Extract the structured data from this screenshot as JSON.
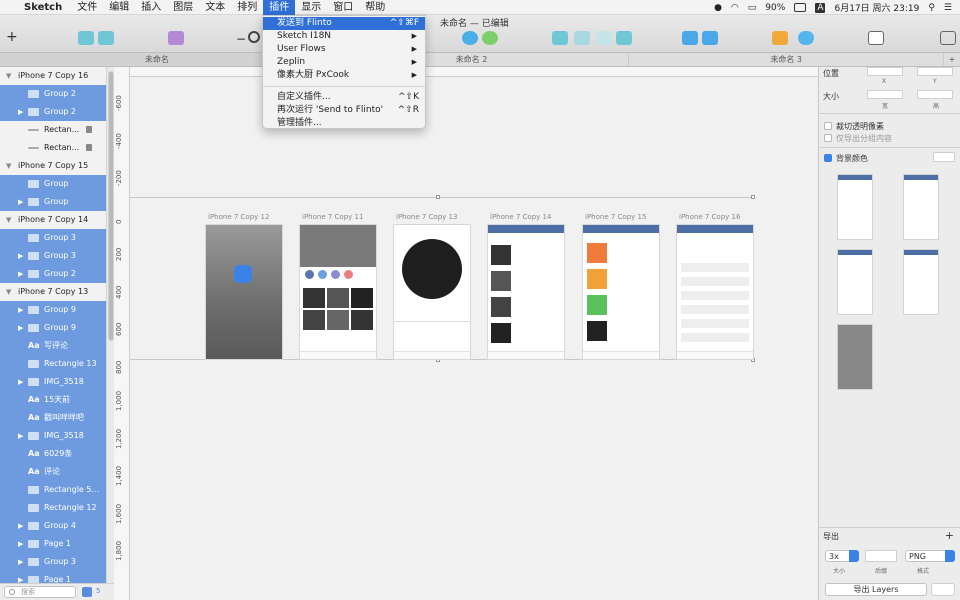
{
  "menubar": {
    "app_name": "Sketch",
    "items": [
      "文件",
      "编辑",
      "插入",
      "图层",
      "文本",
      "排列",
      "插件",
      "显示",
      "窗口",
      "帮助"
    ],
    "battery": "90%",
    "clock": "6月17日 周六  23:19",
    "input_method": "A"
  },
  "document": {
    "title": "未命名 — 已编辑"
  },
  "tabs": [
    "未命名",
    "未命名 2",
    "未命名 3"
  ],
  "plugin_menu": {
    "items": [
      {
        "label": "发送到 Flinto",
        "shortcut": "^⇧⌘F"
      },
      {
        "label": "Sketch I18N",
        "submenu": "▶"
      },
      {
        "label": "User Flows",
        "submenu": "▶"
      },
      {
        "label": "Zeplin",
        "submenu": "▶"
      },
      {
        "label": "像素大厨 PxCook",
        "submenu": "▶"
      }
    ],
    "items2": [
      {
        "label": "自定义插件...",
        "shortcut": "^⇧K"
      },
      {
        "label": "再次运行 'Send to Flinto'",
        "shortcut": "^⇧R"
      },
      {
        "label": "管理插件..."
      }
    ]
  },
  "layers": [
    {
      "kind": "group",
      "label": "iPhone 7 Copy 16"
    },
    {
      "kind": "sel-slice",
      "label": "Group 2"
    },
    {
      "kind": "sel",
      "label": "Group 2"
    },
    {
      "kind": "plain",
      "label": "Rectan...",
      "lock": true
    },
    {
      "kind": "plain",
      "label": "Rectan...",
      "lock": true
    },
    {
      "kind": "group",
      "label": "iPhone 7 Copy 15"
    },
    {
      "kind": "sel-slice",
      "label": "Group"
    },
    {
      "kind": "sel",
      "label": "Group"
    },
    {
      "kind": "group",
      "label": "iPhone 7 Copy 14"
    },
    {
      "kind": "sel-slice",
      "label": "Group 3"
    },
    {
      "kind": "sel",
      "label": "Group 3"
    },
    {
      "kind": "sel",
      "label": "Group 2"
    },
    {
      "kind": "group",
      "label": "iPhone 7 Copy 13"
    },
    {
      "kind": "sel",
      "label": "Group 9"
    },
    {
      "kind": "sel",
      "label": "Group 9"
    },
    {
      "kind": "text",
      "label": "写评论"
    },
    {
      "kind": "rect",
      "label": "Rectangle 13"
    },
    {
      "kind": "sel",
      "label": "IMG_3518"
    },
    {
      "kind": "text",
      "label": "15天前"
    },
    {
      "kind": "text",
      "label": "戳叫咩咩吧"
    },
    {
      "kind": "sel",
      "label": "IMG_3518"
    },
    {
      "kind": "text",
      "label": "6029条"
    },
    {
      "kind": "text",
      "label": "评论"
    },
    {
      "kind": "rect",
      "label": "Rectangle 5..."
    },
    {
      "kind": "rect",
      "label": "Rectangle 12"
    },
    {
      "kind": "sel",
      "label": "Group 4"
    },
    {
      "kind": "sel",
      "label": "Page 1"
    },
    {
      "kind": "sel",
      "label": "Group 3"
    },
    {
      "kind": "sel",
      "label": "Page 1"
    }
  ],
  "layer_footer": {
    "search_placeholder": "搜索",
    "filter_count": "5"
  },
  "ruler_ticks": [
    "-600",
    "-400",
    "-200",
    "0",
    "200",
    "400",
    "600",
    "800",
    "1,000",
    "1,200",
    "1,400",
    "1,600",
    "1,800"
  ],
  "artboards": [
    {
      "label": "iPhone 7 Copy 12"
    },
    {
      "label": "iPhone 7 Copy 11"
    },
    {
      "label": "iPhone 7 Copy 13"
    },
    {
      "label": "iPhone 7 Copy 14"
    },
    {
      "label": "iPhone 7 Copy 15"
    },
    {
      "label": "iPhone 7 Copy 16"
    }
  ],
  "inspector": {
    "position_label": "位置",
    "x_label": "X",
    "y_label": "Y",
    "size_label": "大小",
    "width_label": "宽",
    "height_label": "高",
    "clip_label": "裁切透明像素",
    "export_group_label": "仅导出分组内容",
    "bg_label": "背景颜色",
    "export_label": "导出",
    "scale_value": "3x",
    "format_value": "PNG",
    "scale_caption": "大小",
    "suffix_caption": "后缀",
    "format_caption": "格式",
    "export_button": "导出 Layers"
  },
  "colors": {
    "selection": "#6e9be0",
    "accent": "#3b82e6",
    "menu_highlight": "#2f6fd6"
  }
}
